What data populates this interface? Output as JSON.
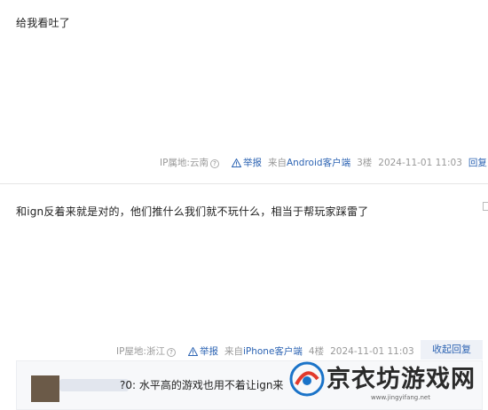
{
  "posts": [
    {
      "content": "给我看吐了",
      "ip": "IP属地:云南",
      "report": "举报",
      "from_prefix": "来自",
      "client": "Android客户端",
      "floor": "3楼",
      "time": "2024-11-01 11:03",
      "reply": "回复"
    },
    {
      "content": "和ign反着来就是对的，他们推什么我们就不玩什么，相当于帮玩家踩雷了",
      "ip": "IP屋地:浙江",
      "report": "举报",
      "from_prefix": "来自",
      "client": "iPhone客户端",
      "floor": "4楼",
      "time": "2024-11-01 11:03",
      "collapse": "收起回复"
    }
  ],
  "reply": {
    "text": "?0: 水平高的游戏也用不着让ign来"
  },
  "watermark": {
    "title": "京衣坊游戏网",
    "url": "www.jingyifang.net"
  },
  "colors": {
    "link": "#2d64b3",
    "meta": "#999999",
    "collapse_bg": "#eef1f7"
  }
}
